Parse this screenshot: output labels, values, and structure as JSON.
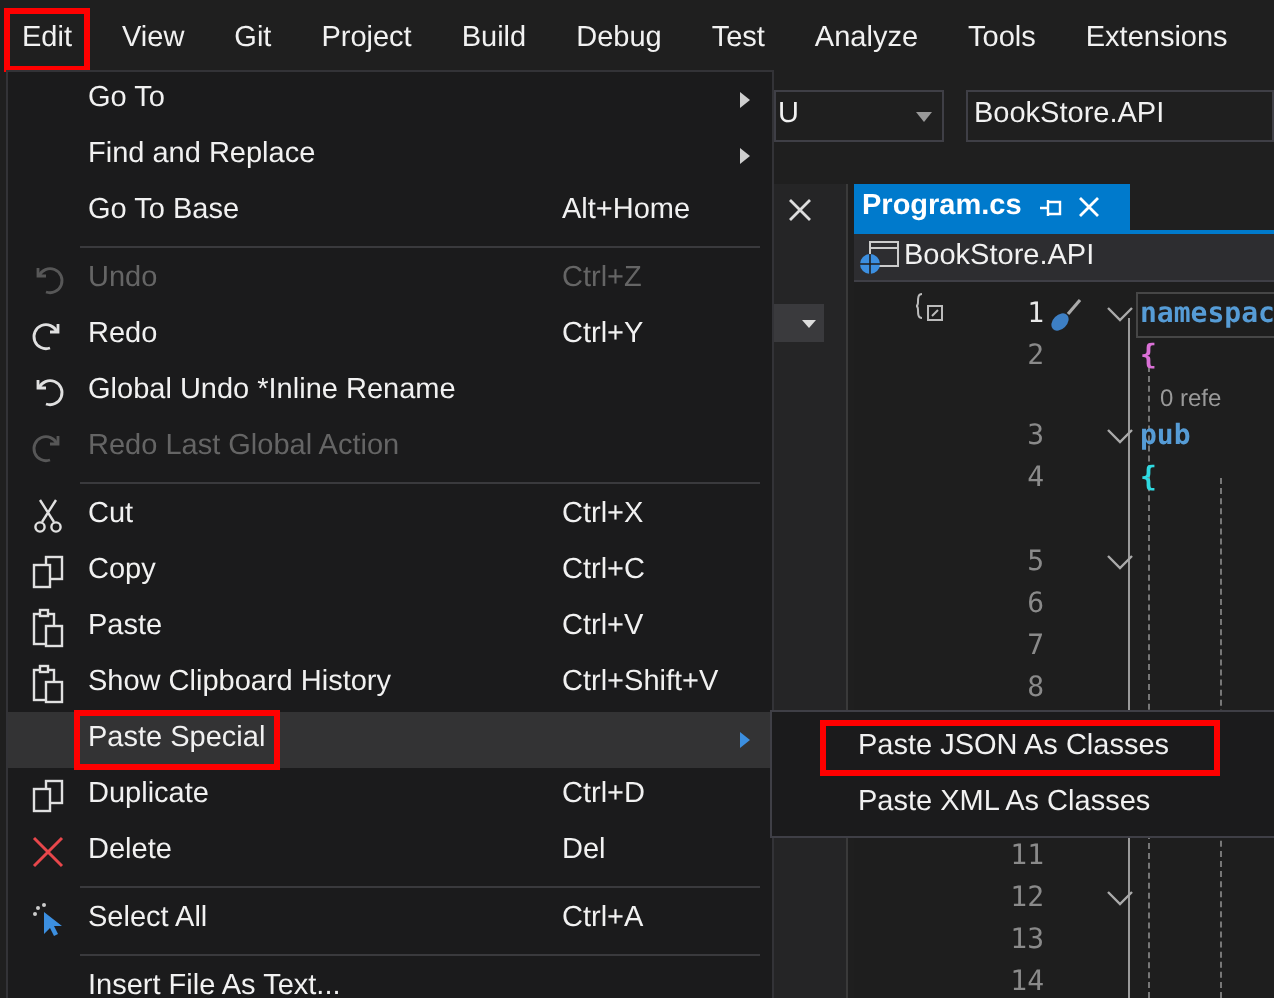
{
  "menu_bar": [
    {
      "label": "Edit",
      "annotated": true
    },
    {
      "label": "View",
      "annotated": false
    },
    {
      "label": "Git",
      "annotated": false
    },
    {
      "label": "Project",
      "annotated": false
    },
    {
      "label": "Build",
      "annotated": false
    },
    {
      "label": "Debug",
      "annotated": false
    },
    {
      "label": "Test",
      "annotated": false
    },
    {
      "label": "Analyze",
      "annotated": false
    },
    {
      "label": "Tools",
      "annotated": false
    },
    {
      "label": "Extensions",
      "annotated": false
    }
  ],
  "edit_menu": [
    {
      "kind": "item",
      "label": "Go To",
      "submenu": true,
      "disabled": false,
      "selected": false,
      "annotated": false
    },
    {
      "kind": "item",
      "label": "Find and Replace",
      "submenu": true,
      "disabled": false,
      "selected": false,
      "annotated": false
    },
    {
      "kind": "item",
      "label": "Go To Base",
      "shortcut": "Alt+Home",
      "submenu": false,
      "disabled": false,
      "selected": false,
      "annotated": false
    },
    {
      "kind": "separator"
    },
    {
      "kind": "item",
      "label": "Undo",
      "shortcut": "Ctrl+Z",
      "submenu": false,
      "disabled": true,
      "selected": false,
      "annotated": false
    },
    {
      "kind": "item",
      "label": "Redo",
      "shortcut": "Ctrl+Y",
      "submenu": false,
      "disabled": false,
      "selected": false,
      "annotated": false
    },
    {
      "kind": "item",
      "label": "Global Undo *Inline Rename",
      "submenu": false,
      "disabled": false,
      "selected": false,
      "annotated": false
    },
    {
      "kind": "item",
      "label": "Redo Last Global Action",
      "submenu": false,
      "disabled": true,
      "selected": false,
      "annotated": false
    },
    {
      "kind": "separator"
    },
    {
      "kind": "item",
      "label": "Cut",
      "shortcut": "Ctrl+X",
      "submenu": false,
      "disabled": false,
      "selected": false,
      "annotated": false
    },
    {
      "kind": "item",
      "label": "Copy",
      "shortcut": "Ctrl+C",
      "submenu": false,
      "disabled": false,
      "selected": false,
      "annotated": false
    },
    {
      "kind": "item",
      "label": "Paste",
      "shortcut": "Ctrl+V",
      "submenu": false,
      "disabled": false,
      "selected": false,
      "annotated": false
    },
    {
      "kind": "item",
      "label": "Show Clipboard History",
      "shortcut": "Ctrl+Shift+V",
      "submenu": false,
      "disabled": false,
      "selected": false,
      "annotated": false
    },
    {
      "kind": "item",
      "label": "Paste Special",
      "submenu": true,
      "disabled": false,
      "selected": true,
      "annotated": true
    },
    {
      "kind": "item",
      "label": "Duplicate",
      "shortcut": "Ctrl+D",
      "submenu": false,
      "disabled": false,
      "selected": false,
      "annotated": false
    },
    {
      "kind": "item",
      "label": "Delete",
      "shortcut": "Del",
      "submenu": false,
      "disabled": false,
      "selected": false,
      "annotated": false
    },
    {
      "kind": "separator"
    },
    {
      "kind": "item",
      "label": "Select All",
      "shortcut": "Ctrl+A",
      "submenu": false,
      "disabled": false,
      "selected": false,
      "annotated": false
    },
    {
      "kind": "separator"
    },
    {
      "kind": "item",
      "label": "Insert File As Text...",
      "submenu": false,
      "disabled": false,
      "selected": false,
      "annotated": false
    }
  ],
  "paste_special_menu": [
    {
      "label": "Paste JSON As Classes",
      "annotated": true
    },
    {
      "label": "Paste XML As Classes",
      "annotated": false
    }
  ],
  "toolbar": {
    "dropdown_value": "U",
    "project_value": "BookStore.API"
  },
  "tab": {
    "title": "Program.cs",
    "selected": true
  },
  "navigation_bar": {
    "project": "BookStore.API"
  },
  "editor_lines": [
    {
      "number": "1",
      "current": true,
      "foldable": true,
      "gap_above": false,
      "code": "namespac",
      "color": "#569cd6"
    },
    {
      "number": "2",
      "current": false,
      "foldable": false,
      "gap_above": false,
      "code": "{",
      "color": "#da70d6"
    },
    {
      "number": "3",
      "current": false,
      "foldable": true,
      "gap_above": false,
      "codelens": "0 refe",
      "code": "pub",
      "color": "#569cd6"
    },
    {
      "number": "4",
      "current": false,
      "foldable": false,
      "gap_above": false,
      "code": "{",
      "color": "#2fd9e0"
    },
    {
      "number": "5",
      "current": false,
      "foldable": true,
      "gap_above": true
    },
    {
      "number": "6",
      "current": false,
      "foldable": false,
      "gap_above": false
    },
    {
      "number": "7",
      "current": false,
      "foldable": false,
      "gap_above": false
    },
    {
      "number": "8",
      "current": false,
      "foldable": false,
      "gap_above": false
    },
    {
      "number": "11",
      "current": false,
      "foldable": false,
      "gap_above": true
    },
    {
      "number": "12",
      "current": false,
      "foldable": true,
      "gap_above": false
    },
    {
      "number": "13",
      "current": false,
      "foldable": false,
      "gap_above": false
    },
    {
      "number": "14",
      "current": false,
      "foldable": false,
      "gap_above": false
    }
  ]
}
